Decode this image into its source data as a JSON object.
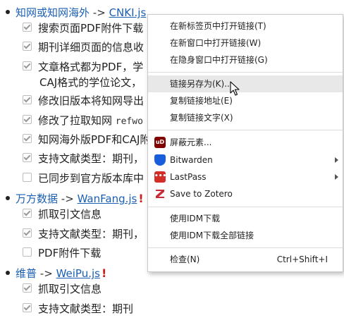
{
  "sections": [
    {
      "site": "知网或知网海外",
      "arrow": "->",
      "script": "CNKI.js",
      "items": [
        {
          "text": "搜索页面PDF附件下载",
          "checked": true
        },
        {
          "text": "期刊详细页面的信息收",
          "checked": true
        },
        {
          "text": "文章格式都为PDF，学",
          "checked": true,
          "cont": "CAJ格式的学位论文，"
        },
        {
          "text": "修改旧版本将知网导出",
          "checked": true
        },
        {
          "text": "修改了拉取知网 ",
          "code": "refwo",
          "checked": true
        },
        {
          "text": "知网海外版PDF和CAJ附",
          "checked": true
        },
        {
          "text": "支持文献类型：期刊，",
          "checked": true
        },
        {
          "text": "已同步到官方版本库中",
          "checked": false
        }
      ]
    },
    {
      "site": "万方数据",
      "arrow": "->",
      "script": "WanFang.js",
      "excl": "!",
      "items": [
        {
          "text": "抓取引文信息",
          "checked": true
        },
        {
          "text": "支持文献类型：期刊，",
          "checked": true
        },
        {
          "text": "PDF附件下载",
          "checked": false
        }
      ]
    },
    {
      "site": "维普",
      "arrow": "->",
      "script": "WeiPu.js",
      "excl": "!",
      "items": [
        {
          "text": "抓取引文信息",
          "checked": true
        },
        {
          "text": "支持文献类型：期刊",
          "checked": true
        }
      ]
    }
  ],
  "menu": {
    "open_new_tab": "在新标签页中打开链接(T)",
    "open_new_window": "在新窗口中打开链接(W)",
    "open_incognito": "在隐身窗口中打开链接(G)",
    "save_link_as": "链接另存为(K)...",
    "copy_link_address": "复制链接地址(E)",
    "copy_link_text": "复制链接文字(X)",
    "block_element": "屏蔽元素...",
    "bitwarden": "Bitwarden",
    "lastpass": "LastPass",
    "save_to_zotero": "Save to Zotero",
    "idm_download": "使用IDM下载",
    "idm_download_all": "使用IDM下载全部链接",
    "inspect": "检查(N)",
    "inspect_shortcut": "Ctrl+Shift+I",
    "ublock_icon_text": "uD",
    "lastpass_icon_text": "•••"
  },
  "colors": {
    "link": "#1a5fb4",
    "warning": "#d01b1b",
    "ublock": "#800000",
    "bitwarden": "#175ddc",
    "lastpass": "#d32d27",
    "zotero": "#cc2936",
    "menu_hover": "#e8e8e8"
  }
}
